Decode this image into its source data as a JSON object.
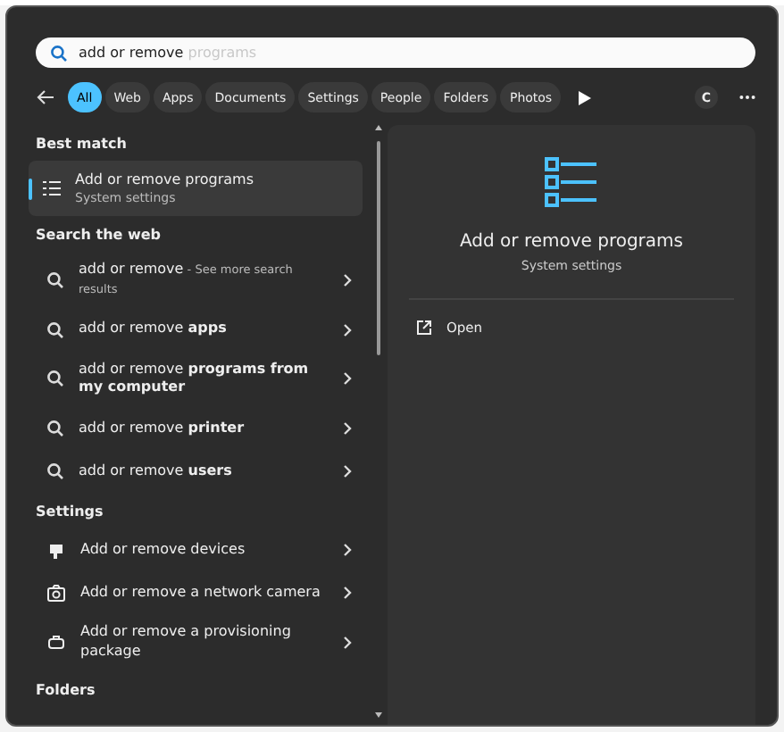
{
  "search": {
    "value": "add or remove",
    "suggestion": "programs"
  },
  "tabs": [
    {
      "label": "All",
      "selected": true
    },
    {
      "label": "Web",
      "selected": false
    },
    {
      "label": "Apps",
      "selected": false
    },
    {
      "label": "Documents",
      "selected": false
    },
    {
      "label": "Settings",
      "selected": false
    },
    {
      "label": "People",
      "selected": false
    },
    {
      "label": "Folders",
      "selected": false
    },
    {
      "label": "Photos",
      "selected": false
    }
  ],
  "account": {
    "initial": "C"
  },
  "best_match": {
    "heading": "Best match",
    "title": "Add or remove programs",
    "subtitle": "System settings",
    "selected": true
  },
  "web": {
    "heading": "Search the web",
    "items": [
      {
        "text": "add or remove",
        "note": " - See more search results"
      },
      {
        "text": "add or remove **apps**"
      },
      {
        "text": "add or remove **programs from my computer**"
      },
      {
        "text": "add or remove **printer**"
      },
      {
        "text": "add or remove **users**"
      }
    ]
  },
  "settings": {
    "heading": "Settings",
    "items": [
      {
        "kind": "devices",
        "text": "Add or remove devices"
      },
      {
        "kind": "camera",
        "text": "Add or remove a network camera"
      },
      {
        "kind": "package",
        "text": "Add or remove a provisioning package"
      }
    ]
  },
  "folders": {
    "heading": "Folders"
  },
  "detail": {
    "title": "Add or remove programs",
    "subtitle": "System settings",
    "actions": [
      "Open"
    ]
  }
}
